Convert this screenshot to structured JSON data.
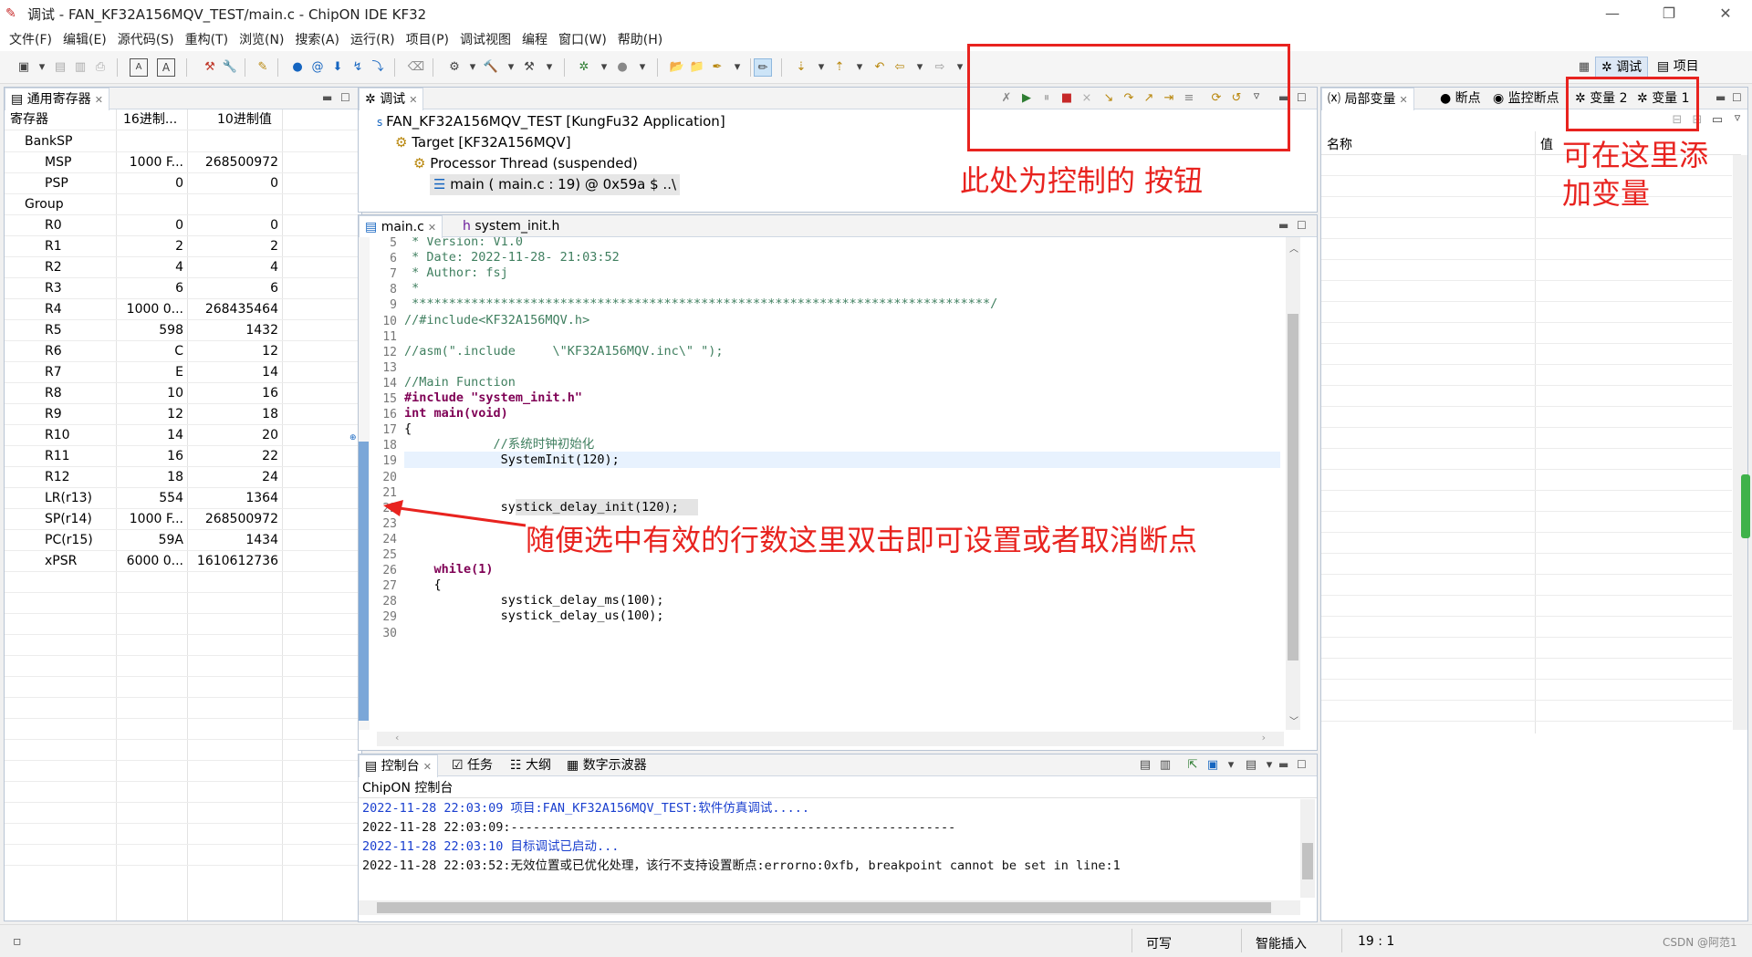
{
  "window": {
    "title": "调试 - FAN_KF32A156MQV_TEST/main.c - ChipON IDE KF32"
  },
  "menu": [
    "文件(F)",
    "编辑(E)",
    "源代码(S)",
    "重构(T)",
    "浏览(N)",
    "搜索(A)",
    "运行(R)",
    "项目(P)",
    "调试视图",
    "编程",
    "窗口(W)",
    "帮助(H)"
  ],
  "perspectives": {
    "debug": "调试",
    "project": "项目"
  },
  "registers": {
    "tab": "通用寄存器",
    "headers": [
      "寄存器",
      "16进制...",
      "10进制值"
    ],
    "rows": [
      [
        "BankSP",
        "",
        ""
      ],
      [
        "MSP",
        "1000 F...",
        "268500972"
      ],
      [
        "PSP",
        "0",
        "0"
      ],
      [
        "Group",
        "",
        ""
      ],
      [
        "R0",
        "0",
        "0"
      ],
      [
        "R1",
        "2",
        "2"
      ],
      [
        "R2",
        "4",
        "4"
      ],
      [
        "R3",
        "6",
        "6"
      ],
      [
        "R4",
        "1000 0...",
        "268435464"
      ],
      [
        "R5",
        "598",
        "1432"
      ],
      [
        "R6",
        "C",
        "12"
      ],
      [
        "R7",
        "E",
        "14"
      ],
      [
        "R8",
        "10",
        "16"
      ],
      [
        "R9",
        "12",
        "18"
      ],
      [
        "R10",
        "14",
        "20"
      ],
      [
        "R11",
        "16",
        "22"
      ],
      [
        "R12",
        "18",
        "24"
      ],
      [
        "LR(r13)",
        "554",
        "1364"
      ],
      [
        "SP(r14)",
        "1000 F...",
        "268500972"
      ],
      [
        "PC(r15)",
        "59A",
        "1434"
      ],
      [
        "xPSR",
        "6000 0...",
        "1610612736"
      ]
    ]
  },
  "debug": {
    "tab": "调试",
    "tree": [
      "FAN_KF32A156MQV_TEST [KungFu32 Application]",
      "Target [KF32A156MQV]",
      "Processor Thread (suspended)",
      "main ( main.c : 19) @ 0x59a $ ..\\"
    ]
  },
  "variables": {
    "tabs": [
      "局部变量",
      "断点",
      "监控断点",
      "变量 2",
      "变量 1"
    ],
    "headers": [
      "名称",
      "值"
    ]
  },
  "editor": {
    "tabs": [
      "main.c",
      "system_init.h"
    ],
    "lines": [
      {
        "n": "5",
        "t": " * Version: V1.0"
      },
      {
        "n": "6",
        "t": " * Date: 2022-11-28- 21:03:52"
      },
      {
        "n": "7",
        "t": " * Author: fsj"
      },
      {
        "n": "8",
        "t": " *"
      },
      {
        "n": "9",
        "t": " ******************************************************************************/"
      },
      {
        "n": "10",
        "t": "//#include<KF32A156MQV.h>"
      },
      {
        "n": "11",
        "t": ""
      },
      {
        "n": "12",
        "t": "//asm(\".include     \\\"KF32A156MQV.inc\\\" \");"
      },
      {
        "n": "13",
        "t": ""
      },
      {
        "n": "14",
        "t": "//Main Function"
      },
      {
        "n": "15",
        "t": "#include \"system_init.h\""
      },
      {
        "n": "16",
        "t": "int main(void)"
      },
      {
        "n": "17",
        "t": "{"
      },
      {
        "n": "18",
        "t": "            //系统时钟初始化"
      },
      {
        "n": "19",
        "t": "             SystemInit(120);"
      },
      {
        "n": "20",
        "t": ""
      },
      {
        "n": "21",
        "t": ""
      },
      {
        "n": "22",
        "t": "             systick_delay_init(120);"
      },
      {
        "n": "23",
        "t": ""
      },
      {
        "n": "24",
        "t": ""
      },
      {
        "n": "25",
        "t": ""
      },
      {
        "n": "26",
        "t": "    while(1)"
      },
      {
        "n": "27",
        "t": "    {"
      },
      {
        "n": "28",
        "t": "             systick_delay_ms(100);"
      },
      {
        "n": "29",
        "t": "             systick_delay_us(100);"
      },
      {
        "n": "30",
        "t": ""
      }
    ]
  },
  "console": {
    "tabs": [
      "控制台",
      "任务",
      "大纲",
      "数字示波器"
    ],
    "title": "ChipON 控制台",
    "lines": [
      "2022-11-28 22:03:09 项目:FAN_KF32A156MQV_TEST:软件仿真调试.....",
      "2022-11-28 22:03:09:------------------------------------------------------------",
      "2022-11-28 22:03:10 目标调试已启动...",
      "2022-11-28 22:03:52:无效位置或已优化处理，该行不支持设置断点:errorno:0xfb, breakpoint cannot be set in line:1"
    ]
  },
  "annotations": {
    "control": "此处为控制的 按钮",
    "vars1": "可在这里添",
    "vars2": "加变量",
    "breakpoint": "随便选中有效的行数这里双击即可设置或者取消断点"
  },
  "status": {
    "writable": "可写",
    "insert": "智能插入",
    "position": "19 :  1",
    "watermark": "CSDN @阿范1"
  }
}
